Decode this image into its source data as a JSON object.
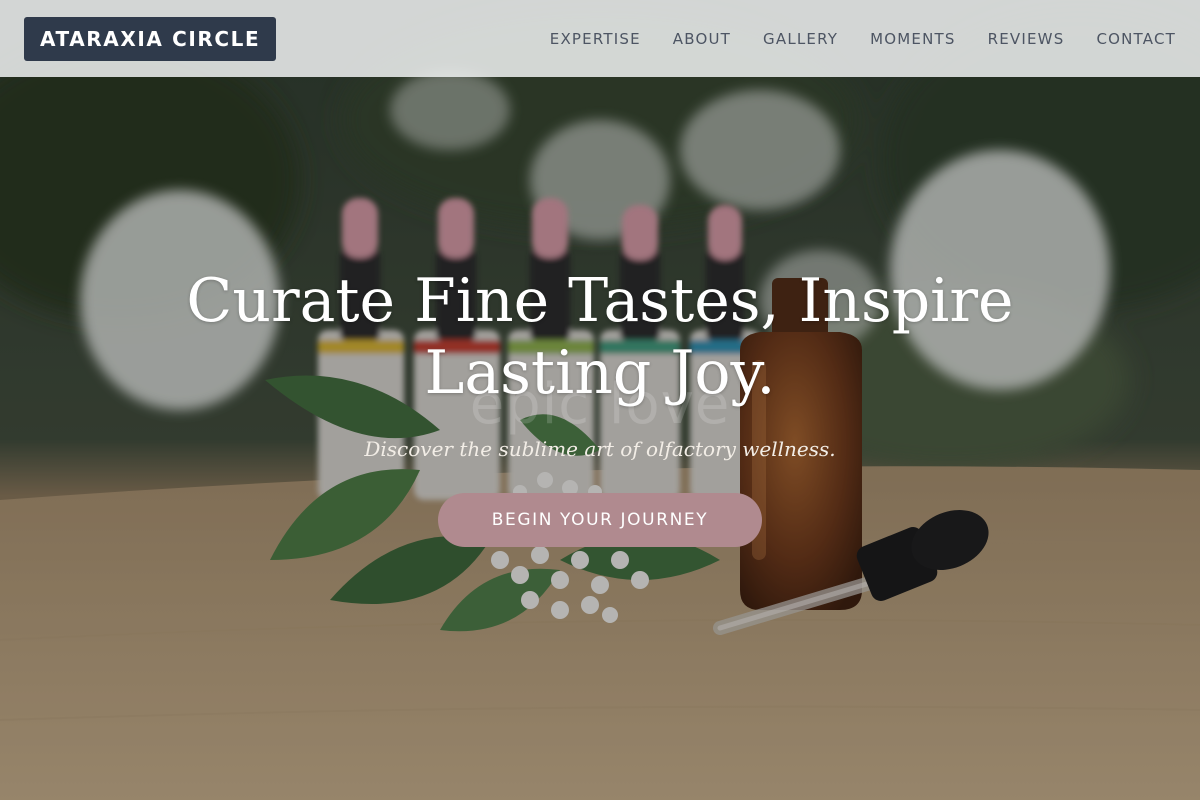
{
  "brand": {
    "name": "ATARAXIA CIRCLE"
  },
  "nav": {
    "items": [
      {
        "label": "EXPERTISE"
      },
      {
        "label": "ABOUT"
      },
      {
        "label": "GALLERY"
      },
      {
        "label": "MOMENTS"
      },
      {
        "label": "REVIEWS"
      },
      {
        "label": "CONTACT"
      }
    ]
  },
  "hero": {
    "title": "Curate Fine Tastes, Inspire Lasting Joy.",
    "ghost_text": "epic love",
    "subtitle": "Discover the sublime art of olfactory wellness.",
    "cta_label": "BEGIN YOUR JOURNEY"
  },
  "colors": {
    "brand_bg": "#2f3a4b",
    "header_bg": "#eceeee",
    "nav_text": "#4d5563",
    "cta_bg": "#b08a8f",
    "hero_text": "#ffffff"
  },
  "icons": []
}
